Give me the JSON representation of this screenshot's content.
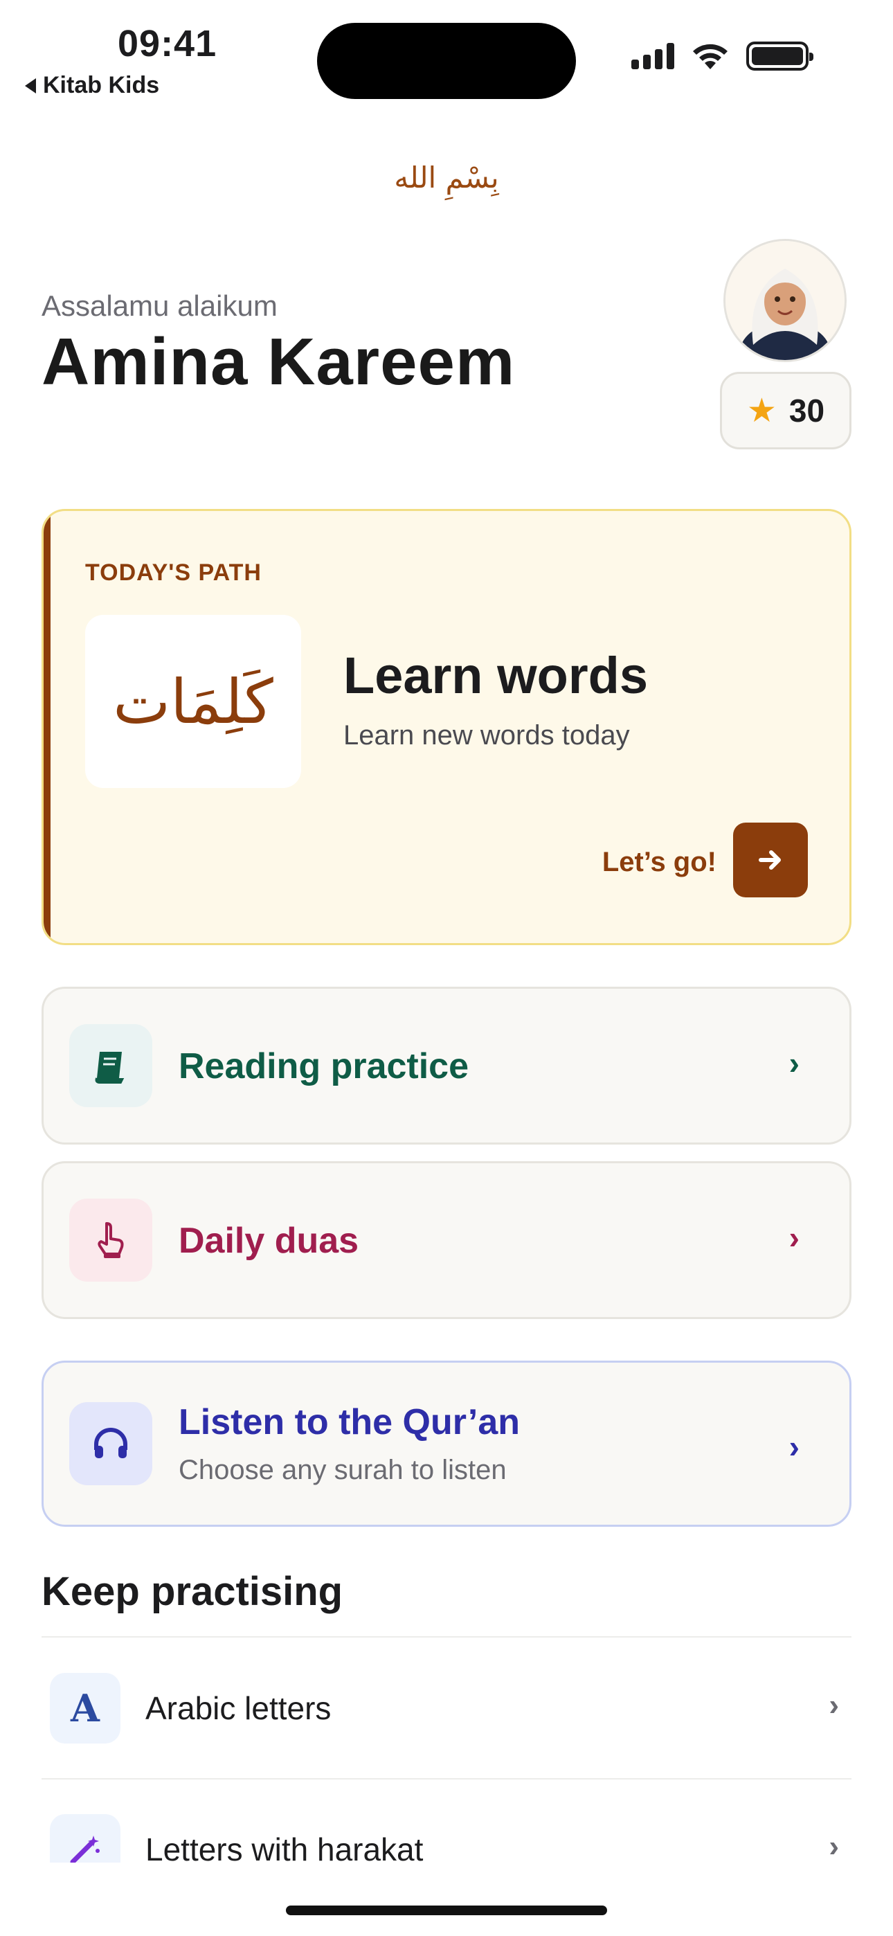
{
  "status_bar": {
    "time": "09:41",
    "back_label": "Kitab Kids"
  },
  "bismillah": "بِسْمِ الله",
  "header": {
    "greeting": "Assalamu alaikum",
    "name": "Amina Kareem",
    "points": "30"
  },
  "todays_path": {
    "label": "TODAY'S PATH",
    "arabic_word": "كَلِمَات",
    "title": "Learn words",
    "subtitle": "Learn new words today",
    "cta": "Let’s go!"
  },
  "actions": [
    {
      "label": "Reading practice",
      "icon": "book-icon"
    },
    {
      "label": "Daily duas",
      "icon": "praying-hand-icon"
    },
    {
      "label": "Listen to the Qur’an",
      "subtitle": "Choose any surah to listen",
      "icon": "headphones-icon"
    }
  ],
  "keep_practising": {
    "title": "Keep practising",
    "items": [
      {
        "label": "Arabic letters",
        "icon": "letter-a-icon"
      },
      {
        "label": "Letters with harakat",
        "icon": "magic-wand-icon"
      }
    ]
  },
  "colors": {
    "brown_accent": "#8b3d0c",
    "green": "#0f5c46",
    "maroon": "#a01e4e",
    "indigo": "#2e2ea8",
    "star": "#f4a413"
  }
}
